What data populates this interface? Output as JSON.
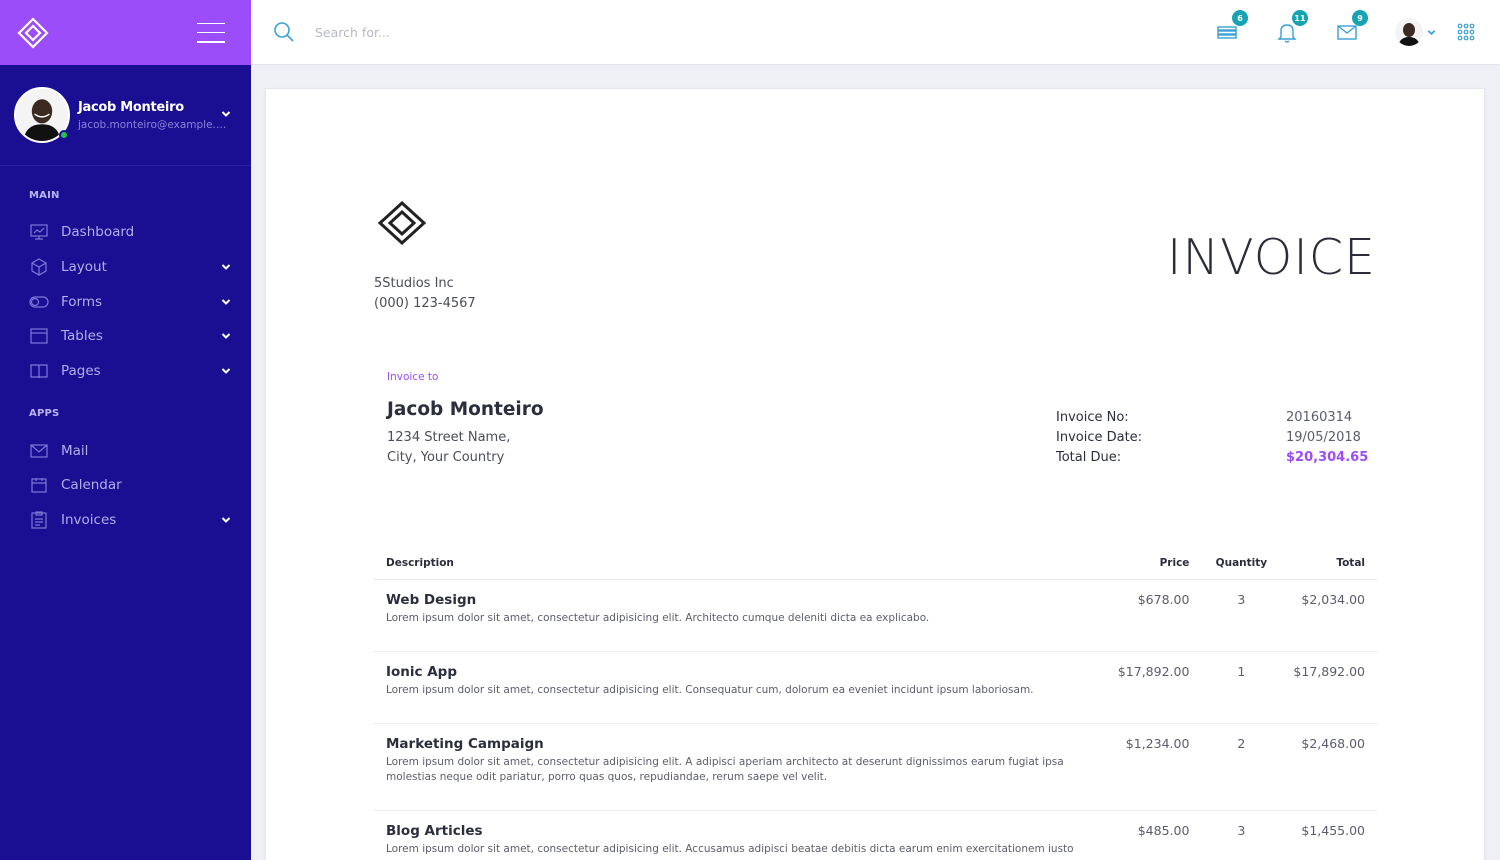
{
  "colors": {
    "sidebar": "#1a0f93",
    "brand": "#9b4dfa",
    "accent": "#9b4dfa",
    "badge": "#18a3b5",
    "online": "#27c24c"
  },
  "sidebar": {
    "brand_icon": "diamond-logo-icon",
    "menu_icon": "hamburger-icon",
    "profile": {
      "name": "Jacob Monteiro",
      "email": "jacob.monteiro@example.com",
      "status": "online"
    },
    "sections": [
      {
        "label": "MAIN",
        "items": [
          {
            "label": "Dashboard",
            "icon": "dashboard-icon",
            "has_submenu": false
          },
          {
            "label": "Layout",
            "icon": "cube-icon",
            "has_submenu": true
          },
          {
            "label": "Forms",
            "icon": "toggle-icon",
            "has_submenu": true
          },
          {
            "label": "Tables",
            "icon": "table-icon",
            "has_submenu": true
          },
          {
            "label": "Pages",
            "icon": "book-icon",
            "has_submenu": true
          }
        ]
      },
      {
        "label": "APPS",
        "items": [
          {
            "label": "Mail",
            "icon": "mail-icon",
            "has_submenu": false
          },
          {
            "label": "Calendar",
            "icon": "calendar-icon",
            "has_submenu": false
          },
          {
            "label": "Invoices",
            "icon": "clipboard-icon",
            "has_submenu": true
          }
        ]
      }
    ]
  },
  "topbar": {
    "search_placeholder": "Search for...",
    "tasks_badge": "6",
    "notifications_badge": "11",
    "messages_badge": "9"
  },
  "invoice": {
    "title": "INVOICE",
    "company": {
      "name": "5Studios Inc",
      "phone": "(000) 123-4567"
    },
    "to_label": "Invoice to",
    "client": {
      "name": "Jacob Monteiro",
      "address_line1": "1234 Street Name,",
      "address_line2": "City, Your Country"
    },
    "meta": [
      {
        "label": "Invoice No:",
        "value": "20160314"
      },
      {
        "label": "Invoice Date:",
        "value": "19/05/2018"
      },
      {
        "label": "Total Due:",
        "value": "$20,304.65"
      }
    ],
    "columns": {
      "description": "Description",
      "price": "Price",
      "quantity": "Quantity",
      "total": "Total"
    },
    "items": [
      {
        "title": "Web Design",
        "text": "Lorem ipsum dolor sit amet, consectetur adipisicing elit. Architecto cumque deleniti dicta ea explicabo.",
        "price": "$678.00",
        "quantity": "3",
        "total": "$2,034.00"
      },
      {
        "title": "Ionic App",
        "text": "Lorem ipsum dolor sit amet, consectetur adipisicing elit. Consequatur cum, dolorum ea eveniet incidunt ipsum laboriosam.",
        "price": "$17,892.00",
        "quantity": "1",
        "total": "$17,892.00"
      },
      {
        "title": "Marketing Campaign",
        "text": "Lorem ipsum dolor sit amet, consectetur adipisicing elit. A adipisci aperiam architecto at deserunt dignissimos earum fugiat ipsa molestias neque odit pariatur, porro quas quos, repudiandae, rerum saepe vel velit.",
        "price": "$1,234.00",
        "quantity": "2",
        "total": "$2,468.00"
      },
      {
        "title": "Blog Articles",
        "text": "Lorem ipsum dolor sit amet, consectetur adipisicing elit. Accusamus adipisci beatae debitis dicta earum enim exercitationem iusto",
        "price": "$485.00",
        "quantity": "3",
        "total": "$1,455.00"
      }
    ]
  }
}
